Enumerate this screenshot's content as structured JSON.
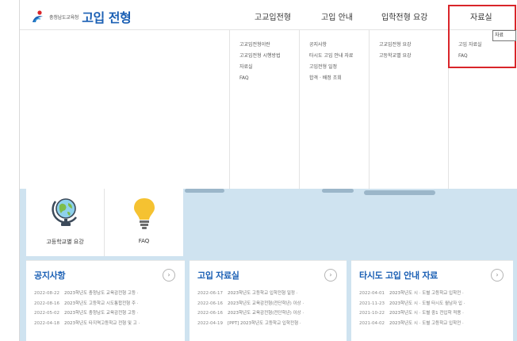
{
  "header": {
    "org_name": "충청남도교육청",
    "site_title": "고입 전형",
    "nav": [
      {
        "label": "고교입전형"
      },
      {
        "label": "고입 안내"
      },
      {
        "label": "입학전형 요강"
      },
      {
        "label": "자료실"
      }
    ]
  },
  "mega_menu": {
    "columns": [
      {
        "items": [
          "고교입전형이란",
          "고교입전형 시행방법",
          "자료실",
          "FAQ"
        ]
      },
      {
        "items": [
          "공지사항",
          "타시도 고입 안내 자료",
          "고입전형 일정",
          "합격 · 배정 조회"
        ]
      },
      {
        "items": [
          "고교입전형 요강",
          "고등학교별 요강"
        ]
      },
      {
        "items": [
          "고입 자료실",
          "FAQ"
        ]
      }
    ],
    "tooltip": "자료",
    "highlight_color": "#d9252a"
  },
  "quick_links": [
    {
      "label": "고등학교별 요강",
      "icon": "globe-icon"
    },
    {
      "label": "FAQ",
      "icon": "lightbulb-icon"
    }
  ],
  "cards": [
    {
      "title": "공지사항",
      "more": "›",
      "rows": [
        {
          "date": "2022-08-22",
          "text": "2023학년도 충청남도 교육감전형 고등 ·"
        },
        {
          "date": "2022-08-16",
          "text": "2023학년도 고등학교 시도통합전형 주 ·"
        },
        {
          "date": "2022-05-02",
          "text": "2023학년도 충청남도 교육감전형 고등 ·"
        },
        {
          "date": "2022-04-18",
          "text": "2023학년도 타지역고등학교 전형 및 고 ·"
        }
      ]
    },
    {
      "title": "고입 자료실",
      "more": "›",
      "rows": [
        {
          "date": "2022-06-17",
          "text": "2023학년도 고등학교 입학전형 일정 ·"
        },
        {
          "date": "2022-06-16",
          "text": "2023학년도 교육감전형(전단학년) 이상 ·"
        },
        {
          "date": "2022-06-16",
          "text": "2023학년도 교육감전형(전단학년) 이상 ·"
        },
        {
          "date": "2022-04-19",
          "text": "[PPT] 2023학년도 고등학교 입학전형 ·"
        }
      ]
    },
    {
      "title": "타시도 고입 안내 자료",
      "more": "›",
      "rows": [
        {
          "date": "2022-04-01",
          "text": "2023학년도 시 · 도별 고등학교 입학전 ·"
        },
        {
          "date": "2021-11-23",
          "text": "2023학년도 시 · 도별 타시도 월남자 입 ·"
        },
        {
          "date": "2021-10-22",
          "text": "2023학년도 시 · 도별 중1 전입학 적용 ·"
        },
        {
          "date": "2021-04-02",
          "text": "2023학년도 시 · 도별 고등학교 입학전 ·"
        }
      ]
    }
  ]
}
